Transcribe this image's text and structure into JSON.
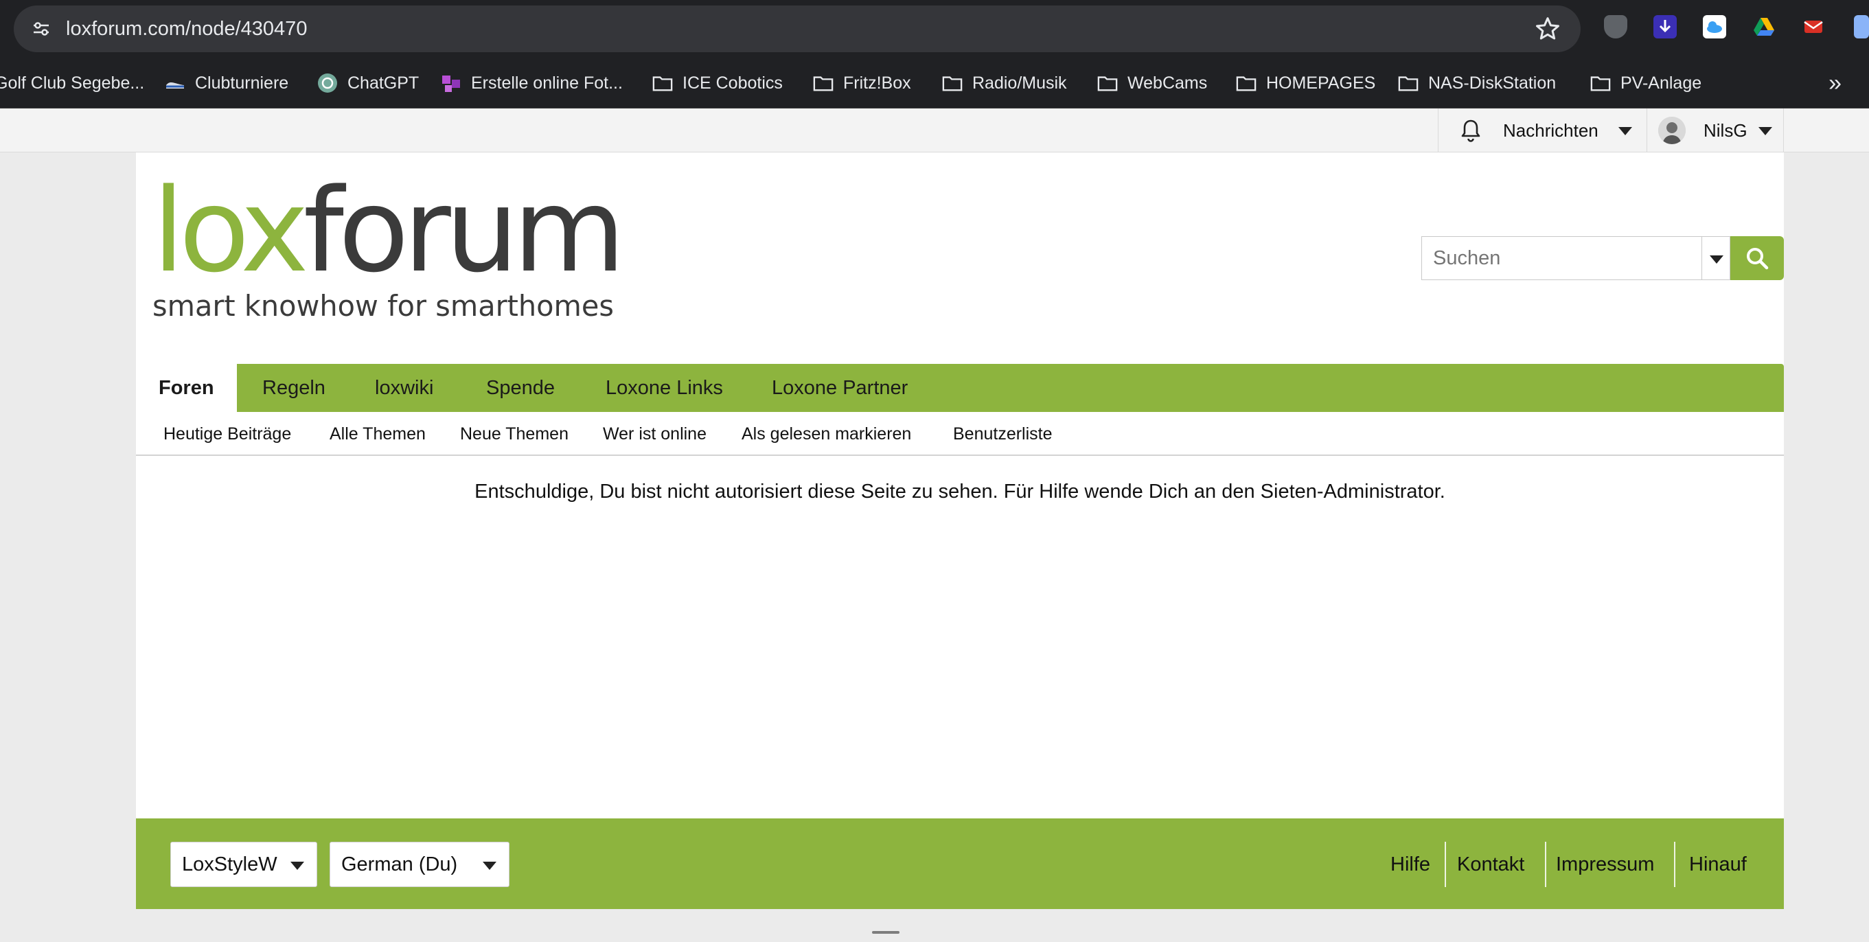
{
  "browser": {
    "url": "loxforum.com/node/430470",
    "bookmarks": [
      {
        "label": "Golf Club Segebe...",
        "icon": "golf-icon"
      },
      {
        "label": "Clubturniere",
        "icon": "shoe-icon"
      },
      {
        "label": "ChatGPT",
        "icon": "chatgpt-icon"
      },
      {
        "label": "Erstelle online Fot...",
        "icon": "photo-app-icon"
      },
      {
        "label": "ICE Cobotics",
        "icon": "folder-icon"
      },
      {
        "label": "Fritz!Box",
        "icon": "folder-icon"
      },
      {
        "label": "Radio/Musik",
        "icon": "folder-icon"
      },
      {
        "label": "WebCams",
        "icon": "folder-icon"
      },
      {
        "label": "HOMEPAGES",
        "icon": "folder-icon"
      },
      {
        "label": "NAS-DiskStation",
        "icon": "folder-icon"
      },
      {
        "label": "PV-Anlage",
        "icon": "folder-icon"
      }
    ],
    "more_label": "»"
  },
  "header": {
    "notifications_label": "Nachrichten",
    "username": "NilsG",
    "search_placeholder": "Suchen"
  },
  "logo": {
    "lox": "lox",
    "forum": "forum",
    "tagline": "smart knowhow for smarthomes"
  },
  "nav": {
    "tabs": [
      "Foren",
      "Regeln",
      "loxwiki",
      "Spende",
      "Loxone Links",
      "Loxone Partner"
    ],
    "subnav": [
      "Heutige Beiträge",
      "Alle Themen",
      "Neue Themen",
      "Wer ist online",
      "Als gelesen markieren",
      "Benutzerliste"
    ]
  },
  "main": {
    "message": "Entschuldige, Du bist nicht autorisiert diese Seite zu sehen. Für Hilfe wende Dich an den Sieten-Administrator."
  },
  "footer": {
    "style_select": "LoxStyleW",
    "language_select": "German (Du)",
    "links": [
      "Hilfe",
      "Kontakt",
      "Impressum",
      "Hinauf"
    ]
  },
  "colors": {
    "brand_green": "#8db43e",
    "logo_gray": "#3b3b3b"
  }
}
